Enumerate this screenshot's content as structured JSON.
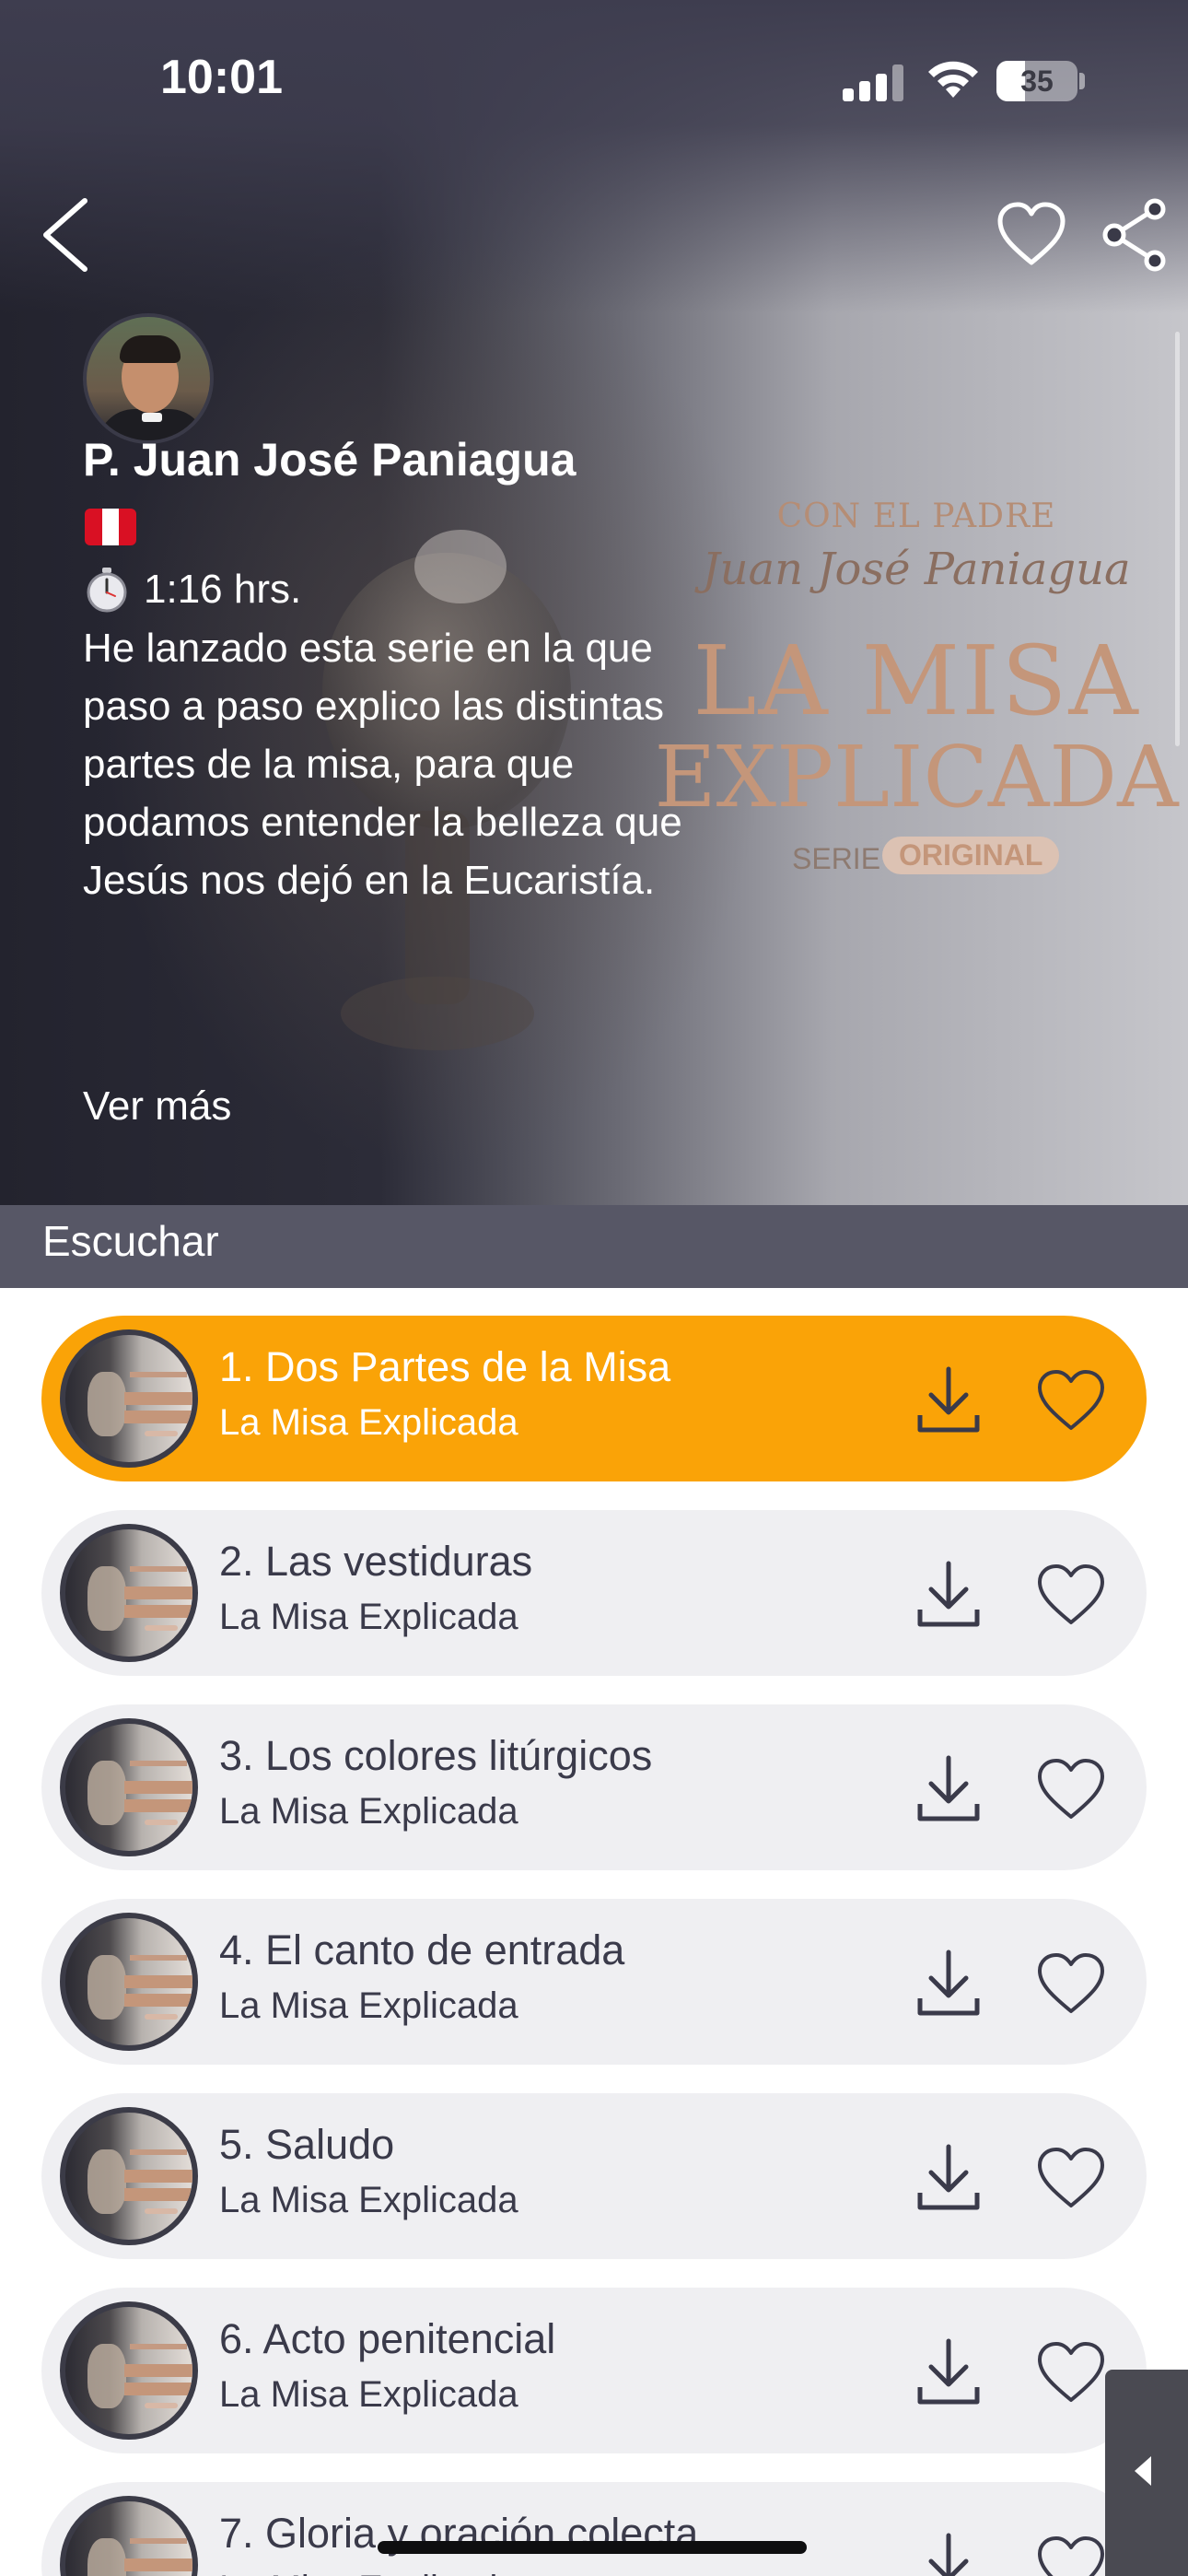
{
  "status_bar": {
    "time": "10:01",
    "battery": "35",
    "battery_level": 0.35
  },
  "header": {
    "back_icon": "chevron-left-icon",
    "favorite_icon": "heart-outline-icon",
    "share_icon": "share-icon"
  },
  "author": {
    "name": "P. Juan José Paniagua",
    "country_flag": "peru-flag-icon"
  },
  "series": {
    "duration": "1:16 hrs.",
    "description": "He lanzado esta serie en la que paso a paso explico las distintas partes de la misa, para que podamos entender la belleza que Jesús nos dejó en la Eucaristía.",
    "more_label": "Ver más",
    "cover": {
      "line1": "CON EL PADRE",
      "line2": "Juan José Paniagua",
      "line3": "LA MISA",
      "line4": "EXPLICADA",
      "serie_label": "SERIE",
      "badge": "ORIGINAL"
    }
  },
  "section": {
    "title": "Escuchar"
  },
  "episodes": [
    {
      "title": "1. Dos Partes de la Misa",
      "subtitle": "La Misa Explicada",
      "active": true
    },
    {
      "title": "2. Las vestiduras",
      "subtitle": "La Misa Explicada",
      "active": false
    },
    {
      "title": "3. Los colores litúrgicos",
      "subtitle": "La Misa Explicada",
      "active": false
    },
    {
      "title": "4. El canto de entrada",
      "subtitle": "La Misa Explicada",
      "active": false
    },
    {
      "title": "5. Saludo",
      "subtitle": "La Misa Explicada",
      "active": false
    },
    {
      "title": "6. Acto penitencial",
      "subtitle": "La Misa Explicada",
      "active": false
    },
    {
      "title": "7. Gloria y oración colecta",
      "subtitle": "La Misa Explicada",
      "active": false
    }
  ],
  "colors": {
    "accent": "#faa307",
    "section_bar": "#575766",
    "episode_bg": "#efeff2",
    "text_dark": "#3a3a4a"
  }
}
